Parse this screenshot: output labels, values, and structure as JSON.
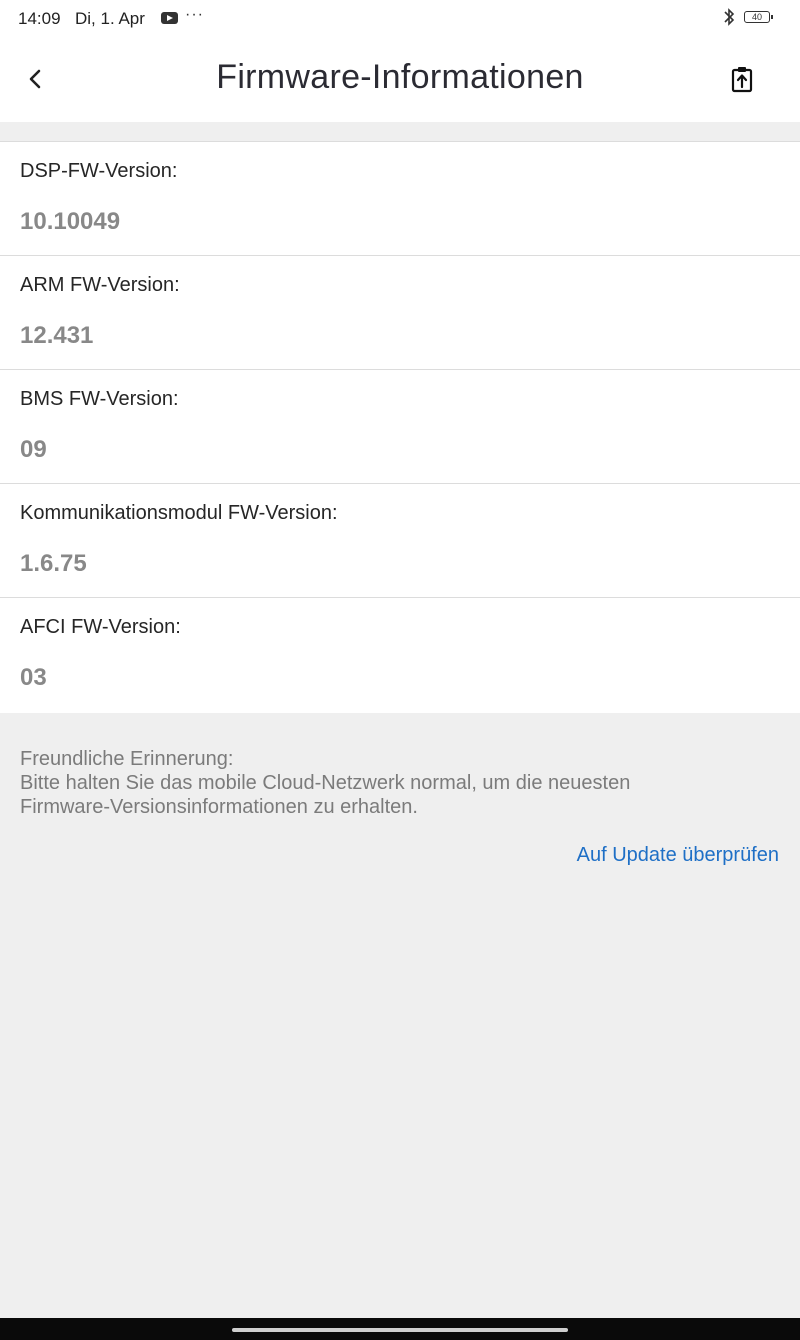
{
  "status_bar": {
    "time": "14:09",
    "date": "Di, 1. Apr",
    "overflow": "···",
    "battery": "40",
    "icons": [
      "youtube-icon",
      "bluetooth-icon",
      "battery-icon"
    ]
  },
  "header": {
    "title": "Firmware-Informationen",
    "back_icon": "chevron-left-icon",
    "action_icon": "clipboard-upload-icon"
  },
  "firmware": [
    {
      "label": "DSP-FW-Version:",
      "value": "10.10049"
    },
    {
      "label": "ARM FW-Version:",
      "value": "12.431"
    },
    {
      "label": "BMS FW-Version:",
      "value": "09"
    },
    {
      "label": "Kommunikationsmodul FW-Version:",
      "value": "1.6.75"
    },
    {
      "label": "AFCI FW-Version:",
      "value": "03"
    }
  ],
  "notice": {
    "heading": "Freundliche Erinnerung:",
    "body": "Bitte halten Sie das mobile Cloud-Netzwerk normal, um die neuesten\nFirmware-Versionsinformationen zu erhalten."
  },
  "actions": {
    "check_update": "Auf Update überprüfen"
  },
  "colors": {
    "background": "#efefef",
    "card": "#ffffff",
    "link": "#1e6fc6",
    "value_text": "#888888"
  }
}
